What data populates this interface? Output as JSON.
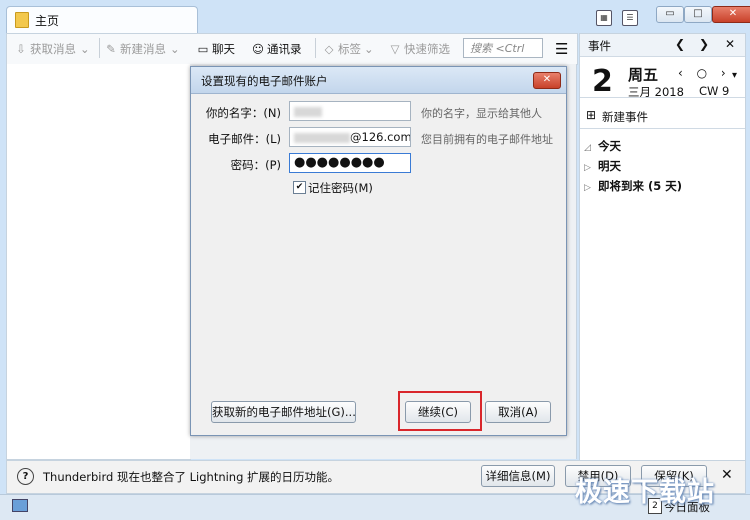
{
  "window": {
    "tab_title": "主页",
    "min_label": "▭",
    "max_label": "□",
    "close_label": "✕"
  },
  "toolbar": {
    "get_messages": "获取消息",
    "new_message": "新建消息",
    "chat": "聊天",
    "address_book": "通讯录",
    "tags": "标签",
    "quick_filter": "快速筛选",
    "search_placeholder": "搜索 <Ctrl"
  },
  "dialog": {
    "title": "设置现有的电子邮件账户",
    "name_label": "你的名字：(N)",
    "name_hint": "你的名字，显示给其他人",
    "email_label": "电子邮件：(L)",
    "email_value_suffix": "@126.com",
    "email_hint": "您目前拥有的电子邮件地址",
    "password_label": "密码：(P)",
    "password_value": "●●●●●●●●",
    "remember_label": "记住密码(M)",
    "remember_checked": true,
    "get_new_button": "获取新的电子邮件地址(G)...",
    "continue_button": "继续(C)",
    "cancel_button": "取消(A)"
  },
  "events": {
    "header": "事件",
    "day_number": "2",
    "weekday": "周五",
    "month_year": "三月 2018",
    "week": "CW 9",
    "new_event": "新建事件",
    "groups": [
      {
        "label": "今天"
      },
      {
        "label": "明天"
      },
      {
        "label": "即将到来 (5 天)"
      }
    ]
  },
  "notification": {
    "message": "Thunderbird 现在也整合了 Lightning 扩展的日历功能。",
    "details_button": "详细信息(M)",
    "disable_button": "禁用(D)",
    "keep_button": "保留(K)"
  },
  "statusbar": {
    "today_pane": "今日面板"
  },
  "watermark": "极速下载站",
  "colors": {
    "highlight_box": "#d9262b",
    "accent": "#3a7bd5"
  }
}
